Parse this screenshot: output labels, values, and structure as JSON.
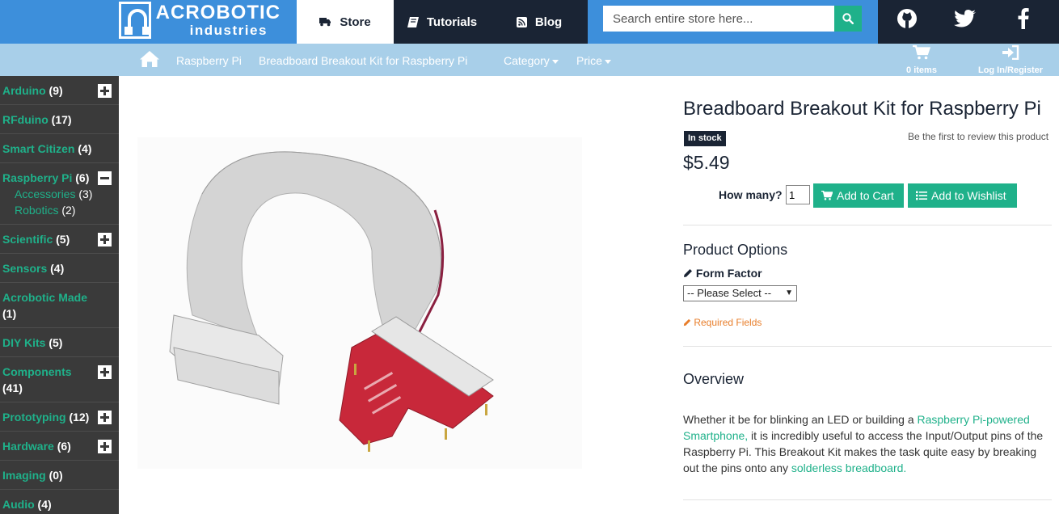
{
  "brand": {
    "line1": "ACROBOTIC",
    "line2": "industries"
  },
  "nav": {
    "store": "Store",
    "tutorials": "Tutorials",
    "blog": "Blog"
  },
  "search": {
    "placeholder": "Search entire store here..."
  },
  "social": [
    "github-icon",
    "twitter-icon",
    "facebook-icon"
  ],
  "breadcrumb": {
    "item1": "Raspberry Pi",
    "item2": "Breadboard Breakout Kit for Raspberry Pi"
  },
  "filters": {
    "category": "Category",
    "price": "Price"
  },
  "cart": {
    "label": "0 items"
  },
  "account": {
    "label": "Log In/Register"
  },
  "sidebar": {
    "items": [
      {
        "name": "Arduino",
        "count": "(9)",
        "toggle": "plus"
      },
      {
        "name": "RFduino",
        "count": "(17)",
        "toggle": ""
      },
      {
        "name": "Smart Citizen",
        "count": "(4)",
        "toggle": ""
      },
      {
        "name": "Raspberry Pi",
        "count": "(6)",
        "toggle": "minus"
      },
      {
        "name": "Scientific",
        "count": "(5)",
        "toggle": "plus"
      },
      {
        "name": "Sensors",
        "count": "(4)",
        "toggle": ""
      },
      {
        "name": "Acrobotic Made",
        "count": "(1)",
        "toggle": ""
      },
      {
        "name": "DIY Kits",
        "count": "(5)",
        "toggle": ""
      },
      {
        "name": "Components",
        "count": "(41)",
        "toggle": "plus"
      },
      {
        "name": "Prototyping",
        "count": "(12)",
        "toggle": "plus"
      },
      {
        "name": "Hardware",
        "count": "(6)",
        "toggle": "plus"
      },
      {
        "name": "Imaging",
        "count": "(0)",
        "toggle": ""
      },
      {
        "name": "Audio",
        "count": "(4)",
        "toggle": ""
      }
    ],
    "subitems": [
      {
        "name": "Accessories",
        "count": "(3)"
      },
      {
        "name": "Robotics",
        "count": "(2)"
      }
    ]
  },
  "product": {
    "title": "Breadboard Breakout Kit for Raspberry Pi",
    "stock": "In stock",
    "review": "Be the first to review this product",
    "price": "$5.49",
    "qty_label": "How many?",
    "qty_value": "1",
    "add_to_cart": "Add to Cart",
    "add_to_wishlist": "Add to Wishlist",
    "options_heading": "Product Options",
    "form_factor_label": "Form Factor",
    "form_factor_selected": "-- Please Select --",
    "required_note": "Required Fields",
    "overview_heading": "Overview",
    "overview": {
      "p1": "Whether it be for blinking an LED or building a ",
      "link1": "Raspberry Pi-powered Smartphone,",
      "p2": " it is incredibly useful to access the Input/Output pins of the Raspberry Pi. This Breakout Kit makes the task quite easy by breaking out the pins onto any ",
      "link2": "solderless breadboard."
    }
  },
  "colors": {
    "blue": "#3d8fdb",
    "navy": "#1a2434",
    "teal": "#1fb18a",
    "light_blue": "#a8cfe9",
    "sidebar": "#3a3a3a",
    "orange": "#e87e2b"
  }
}
